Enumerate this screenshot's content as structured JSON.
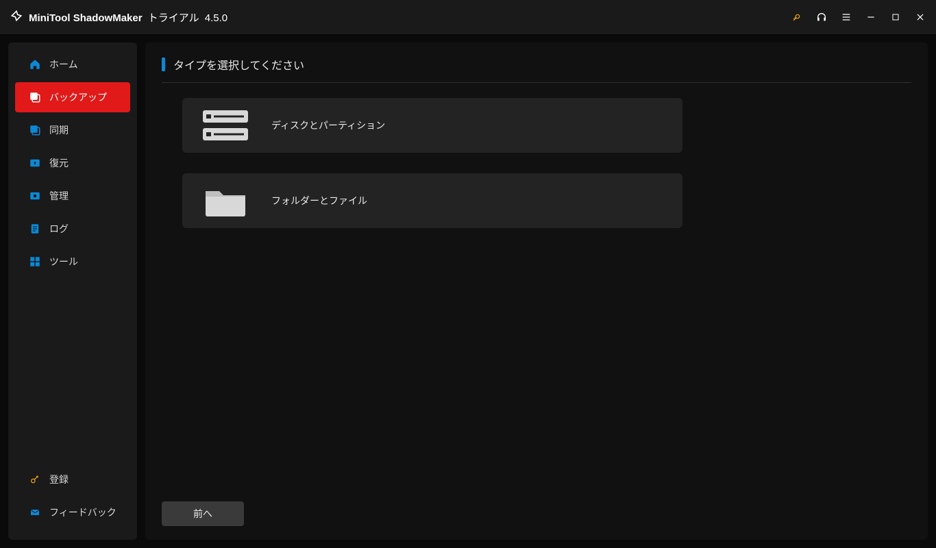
{
  "titlebar": {
    "app_name": "MiniTool ShadowMaker",
    "edition": "トライアル",
    "version": "4.5.0"
  },
  "sidebar": {
    "items": [
      {
        "label": "ホーム"
      },
      {
        "label": "バックアップ"
      },
      {
        "label": "同期"
      },
      {
        "label": "復元"
      },
      {
        "label": "管理"
      },
      {
        "label": "ログ"
      },
      {
        "label": "ツール"
      }
    ],
    "bottom": [
      {
        "label": "登録"
      },
      {
        "label": "フィードバック"
      }
    ]
  },
  "main": {
    "title": "タイプを選択してください",
    "options": [
      {
        "label": "ディスクとパーティション"
      },
      {
        "label": "フォルダーとファイル"
      }
    ],
    "footer": {
      "prev": "前へ"
    }
  }
}
